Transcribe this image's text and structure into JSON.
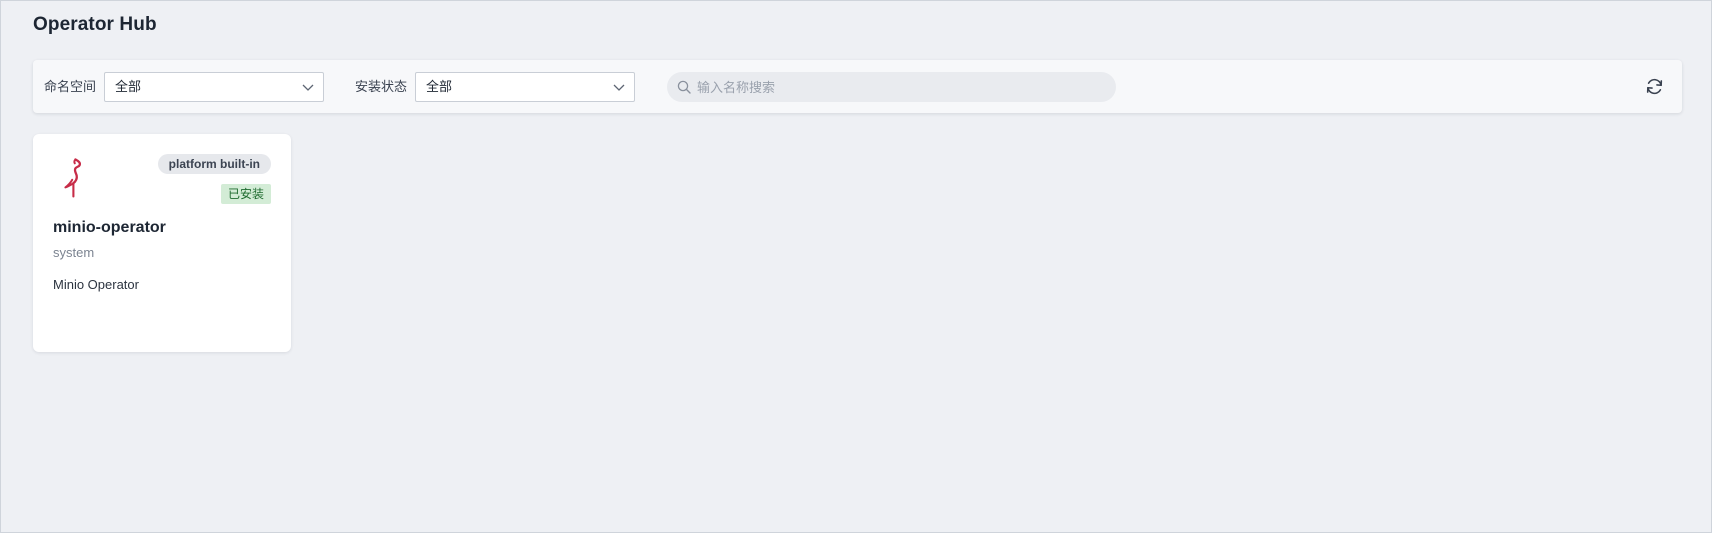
{
  "page": {
    "title": "Operator Hub"
  },
  "filters": {
    "namespace_label": "命名空间",
    "namespace_value": "全部",
    "status_label": "安装状态",
    "status_value": "全部",
    "search_placeholder": "输入名称搜索",
    "search_value": ""
  },
  "icons": {
    "chevron": "chevron-down-icon",
    "search": "search-icon",
    "refresh": "refresh-icon",
    "logo": "minio-logo-icon"
  },
  "colors": {
    "background": "#eef0f4",
    "installed_badge_bg": "#d3ecd6",
    "installed_badge_text": "#1f6b2f",
    "minio_brand": "#c72c48"
  },
  "operators": [
    {
      "name": "minio-operator",
      "namespace": "system",
      "description": "Minio Operator",
      "source_badge": "platform built-in",
      "status_badge": "已安装"
    }
  ]
}
